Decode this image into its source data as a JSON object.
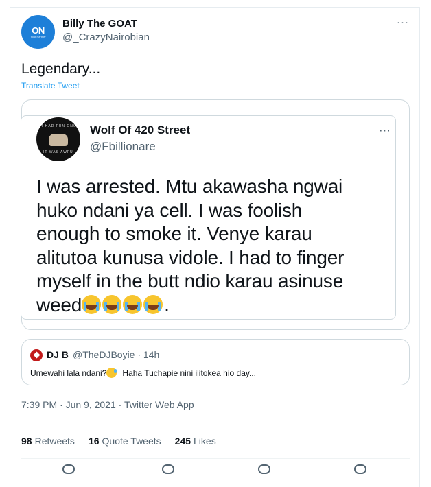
{
  "tweet": {
    "author_name": "Billy The GOAT",
    "author_handle": "@_CrazyNairobian",
    "avatar_monogram": "ON",
    "avatar_tagline": "Your Partner",
    "more_label": "···",
    "text": "Legendary...",
    "translate_label": "Translate Tweet",
    "timestamp": "7:39 PM · Jun 9, 2021 · Twitter Web App"
  },
  "quoted": {
    "author_name": "Wolf Of 420 Street",
    "author_handle": "@Fbillionare",
    "avatar_top_text": "I HAD FUN ONC",
    "avatar_bottom_text": "IT WAS AWFU",
    "more_label": "···",
    "body": "I was arrested. Mtu akawasha ngwai\nhuko ndani ya cell. I was foolish\nenough to smoke it. Venye karau\nalitutoa kunusa vidole. I had to finger\nmyself in the butt ndio karau asinuse\nweed",
    "body_end": "."
  },
  "reply": {
    "author_name": "DJ B",
    "meta": "@TheDJBoyie · 14h",
    "text_part1": "Umewahi lala ndani?",
    "text_part2": "Haha Tuchapie nini ilitokea hio day..."
  },
  "stats": {
    "retweets_count": "98",
    "retweets_label": "Retweets",
    "quotes_count": "16",
    "quotes_label": "Quote Tweets",
    "likes_count": "245",
    "likes_label": "Likes"
  },
  "icons": [
    "reply-icon",
    "retweet-icon",
    "like-icon",
    "share-icon"
  ],
  "colors": {
    "link": "#1d9bf0",
    "muted": "#536471",
    "avatar_bg": "#1d7fd8"
  }
}
